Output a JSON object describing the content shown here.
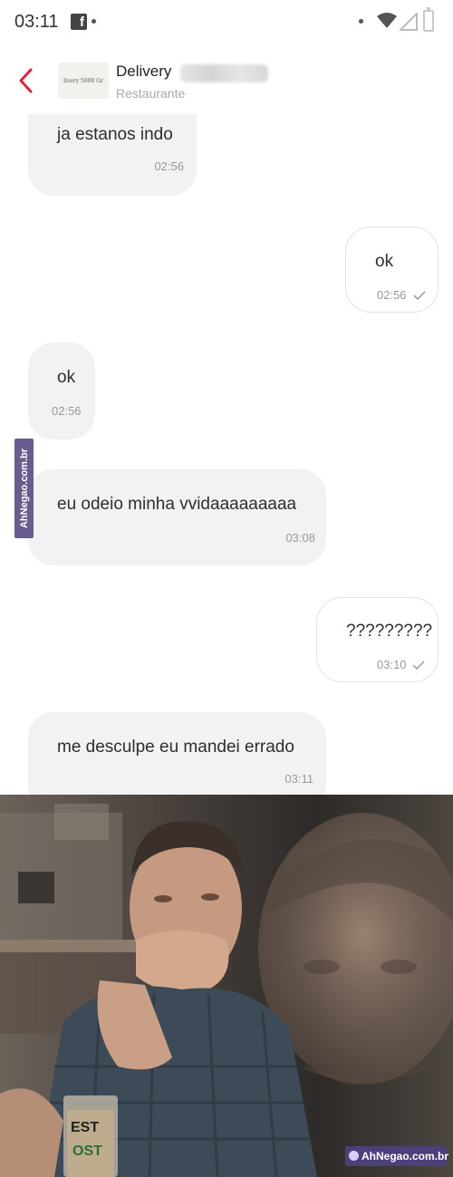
{
  "status_bar": {
    "time": "03:11",
    "fb_letter": "f"
  },
  "header": {
    "contact_name": "Delivery",
    "subtitle": "Restaurante",
    "avatar_text": "livery 5000 Gr"
  },
  "messages": [
    {
      "direction": "in",
      "text": "ja estanos indo",
      "time": "02:56",
      "read": false
    },
    {
      "direction": "out",
      "text": "ok",
      "time": "02:56",
      "read": true
    },
    {
      "direction": "in",
      "text": "ok",
      "time": "02:56",
      "read": false
    },
    {
      "direction": "in",
      "text": "eu odeio minha vvidaaaaaaaaa",
      "time": "03:08",
      "read": false
    },
    {
      "direction": "out",
      "text": "?????????",
      "time": "03:10",
      "read": true
    },
    {
      "direction": "in",
      "text": "me desculpe eu mandei errado",
      "time": "03:11",
      "read": false
    }
  ],
  "watermarks": {
    "side": "AhNegao.com.br",
    "bottom": "AhNegao.com.br",
    "glass_text_1": "EST",
    "glass_text_2": "OST"
  },
  "colors": {
    "accent": "#d8263a",
    "incoming_bubble": "#f2f2f2",
    "outgoing_border": "#e2e2e2",
    "watermark": "#4c3f7a"
  },
  "icons": [
    "back-arrow-icon",
    "facebook-icon",
    "wifi-icon",
    "signal-icon",
    "battery-icon",
    "check-icon"
  ]
}
